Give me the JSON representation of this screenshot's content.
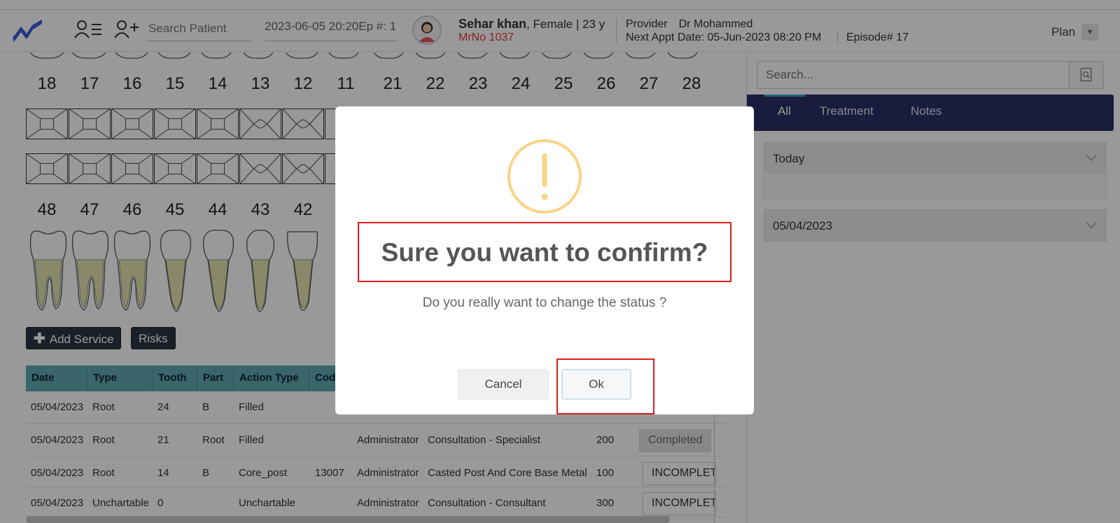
{
  "header": {
    "search_placeholder": "Search Patient",
    "episode_select": "2023-06-05 20:20Ep #: 1",
    "patient_name": "Sehar khan",
    "patient_meta": ", Female | 23 y",
    "mrn": "MrNo 1037",
    "provider_label": "Provider",
    "provider_name": "Dr Mohammed",
    "next_appt": "Next Appt Date: 05-Jun-2023 08:20 PM",
    "episode_no": "Episode# 17",
    "plan_label": "Plan"
  },
  "chart": {
    "upper_teeth": [
      "18",
      "17",
      "16",
      "15",
      "14",
      "13",
      "12",
      "11",
      "21",
      "22",
      "23",
      "24",
      "25",
      "26",
      "27",
      "28"
    ],
    "lower_teeth_visible": [
      "48",
      "47",
      "46",
      "45",
      "44",
      "43",
      "42"
    ],
    "buttons": {
      "add_service": "Add Service",
      "risks": "Risks"
    }
  },
  "table": {
    "columns": [
      "Date",
      "Type",
      "Tooth",
      "Part",
      "Action Type",
      "Cod"
    ],
    "rows": [
      {
        "date": "05/04/2023",
        "type": "Root",
        "tooth": "24",
        "part": "B",
        "action": "Filled",
        "code": "",
        "by": "",
        "service": "",
        "price": "",
        "status": ""
      },
      {
        "date": "05/04/2023",
        "type": "Root",
        "tooth": "21",
        "part": "Root",
        "action": "Filled",
        "code": "",
        "by": "Administrator",
        "service": "Consultation - Specialist",
        "price": "200",
        "status": "Completed"
      },
      {
        "date": "05/04/2023",
        "type": "Root",
        "tooth": "14",
        "part": "B",
        "action": "Core_post",
        "code": "13007",
        "by": "Administrator",
        "service": "Casted Post And Core Base Metal",
        "price": "100",
        "status": "INCOMPLETE"
      },
      {
        "date": "05/04/2023",
        "type": "Unchartable",
        "tooth": "0",
        "part": "",
        "action": "Unchartable",
        "code": "",
        "by": "Administrator",
        "service": "Consultation - Consultant",
        "price": "300",
        "status": "INCOMPLETE"
      }
    ]
  },
  "sidebar": {
    "search_placeholder": "Search...",
    "tabs": [
      "All",
      "Treatment",
      "Notes"
    ],
    "active_tab": "All",
    "sections": [
      "Today",
      "05/04/2023"
    ]
  },
  "modal": {
    "icon": "warning-icon",
    "title": "Sure you want to confirm?",
    "text": "Do you really want to change the status ?",
    "cancel_label": "Cancel",
    "ok_label": "Ok"
  },
  "colors": {
    "accent_navy": "#2c2f66",
    "table_header": "#5fa8b3",
    "warning": "#f8d486",
    "highlight_red": "#e01b1b",
    "mrn_red": "#e03a3a"
  }
}
